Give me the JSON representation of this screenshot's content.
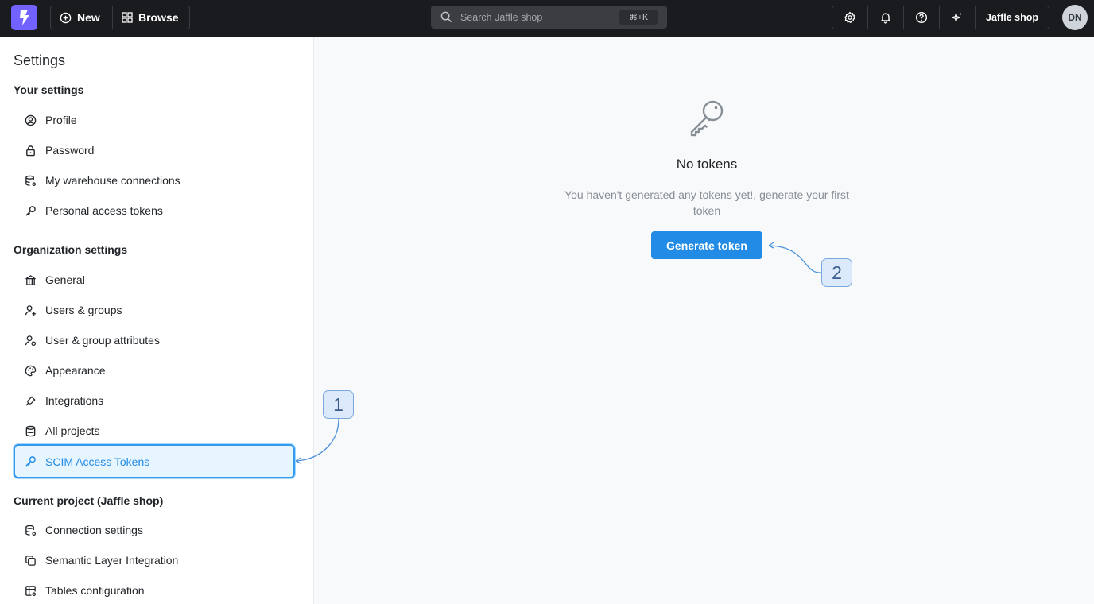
{
  "topbar": {
    "new_label": "New",
    "browse_label": "Browse",
    "search_placeholder": "Search Jaffle shop",
    "search_shortcut": "⌘+K",
    "project_label": "Jaffle shop",
    "avatar_initials": "DN"
  },
  "sidebar": {
    "title": "Settings",
    "your_settings": {
      "heading": "Your settings",
      "items": [
        {
          "label": "Profile",
          "icon": "user-circle-icon"
        },
        {
          "label": "Password",
          "icon": "lock-icon"
        },
        {
          "label": "My warehouse connections",
          "icon": "database-cog-icon"
        },
        {
          "label": "Personal access tokens",
          "icon": "key-icon"
        }
      ]
    },
    "organization_settings": {
      "heading": "Organization settings",
      "items": [
        {
          "label": "General",
          "icon": "building-bank-icon"
        },
        {
          "label": "Users & groups",
          "icon": "user-plus-icon"
        },
        {
          "label": "User & group attributes",
          "icon": "user-attributes-icon"
        },
        {
          "label": "Appearance",
          "icon": "palette-icon"
        },
        {
          "label": "Integrations",
          "icon": "plug-icon"
        },
        {
          "label": "All projects",
          "icon": "database-icon"
        },
        {
          "label": "SCIM Access Tokens",
          "icon": "key-icon",
          "active": true
        }
      ]
    },
    "current_project": {
      "heading": "Current project (Jaffle shop)",
      "items": [
        {
          "label": "Connection settings",
          "icon": "database-cog-icon"
        },
        {
          "label": "Semantic Layer Integration",
          "icon": "layers-icon"
        },
        {
          "label": "Tables configuration",
          "icon": "table-options-icon"
        }
      ]
    }
  },
  "main": {
    "empty_title": "No tokens",
    "empty_description": "You haven't generated any tokens yet!, generate your first token",
    "generate_button": "Generate token"
  },
  "callouts": [
    "1",
    "2"
  ],
  "colors": {
    "topbar_bg": "#1a1b1e",
    "logo_bg": "#7262ff",
    "primary": "#228be6",
    "active_bg": "#e7f5ff",
    "callout_bg": "#dbe9fb"
  }
}
